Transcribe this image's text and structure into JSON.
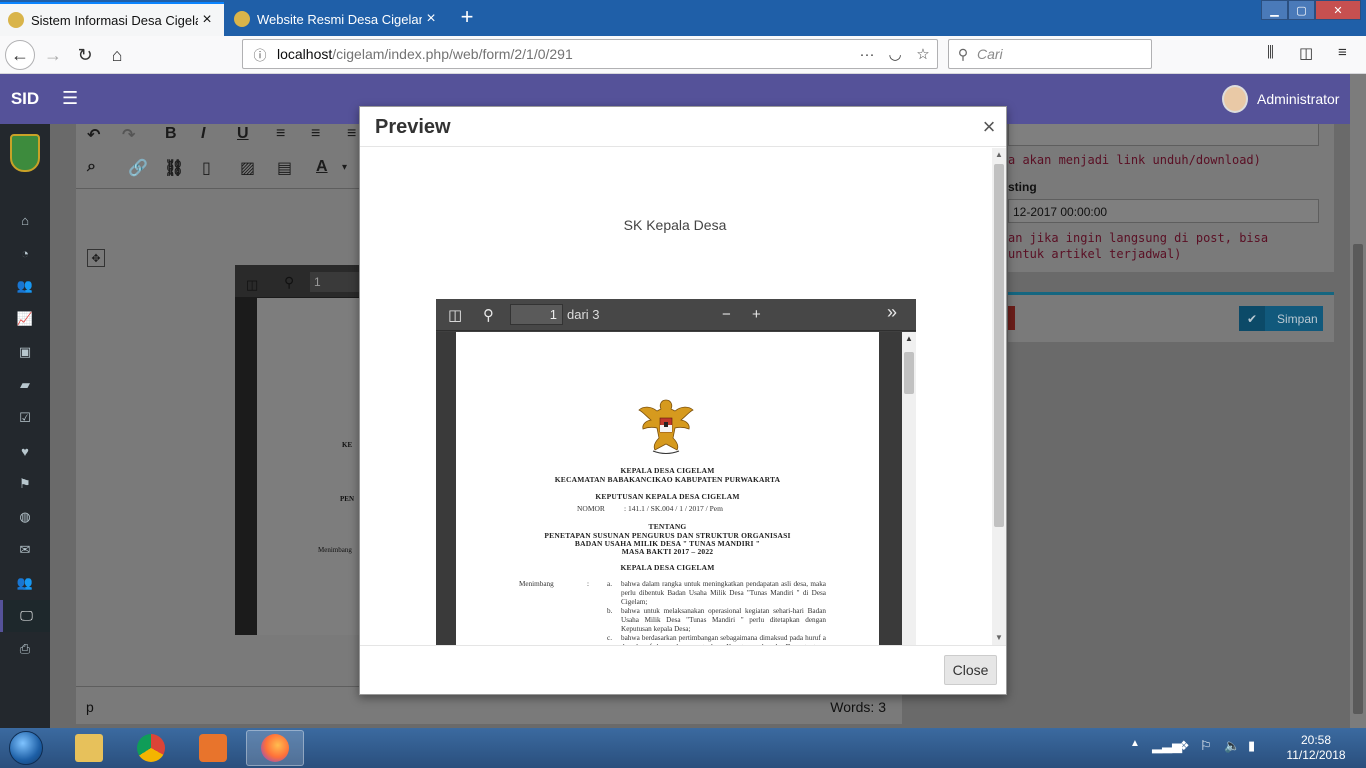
{
  "browser": {
    "tabs": [
      {
        "title": "Sistem Informasi Desa Cigelam",
        "close": "×"
      },
      {
        "title": "Website Resmi Desa Cigelam -",
        "close": "×"
      }
    ],
    "new_tab": "+",
    "url_host": "localhost",
    "url_path": "/cigelam/index.php/web/form/2/1/0/291",
    "search_placeholder": "Cari"
  },
  "app": {
    "logo": "SID",
    "user_name": "Administrator"
  },
  "underlay": {
    "right_hint_1": "a akan menjadi link unduh/download)",
    "posting_label": "sting",
    "posting_value": "12-2017 00:00:00",
    "right_hint_2": "an jika ingin langsung di post, bisa",
    "right_hint_3": " untuk artikel terjadwal)",
    "save_label": "Simpan",
    "status_path": "p",
    "word_count": "Words: 3",
    "pdf_under_page": "1",
    "doc_under_1": "KE",
    "doc_under_2": "PEN",
    "doc_under_3": "Menimbang"
  },
  "modal": {
    "title": "Preview",
    "close_icon": "×",
    "document_title": "SK Kepala Desa",
    "close_button": "Close"
  },
  "pdf_viewer": {
    "page_number": "1",
    "page_total": "dari 3",
    "zoom_out": "−",
    "zoom_in": "+",
    "more": "»"
  },
  "document": {
    "heading_1": "KEPALA DESA CIGELAM",
    "heading_2": "KECAMATAN BABAKANCIKAO KABUPATEN PURWAKARTA",
    "heading_3": "KEPUTUSAN KEPALA DESA CIGELAM",
    "number_label": "NOMOR",
    "number_value": ": 141.1 / SK.004 / 1 / 2017 / Pem",
    "about": "TENTANG",
    "subject_1": "PENETAPAN SUSUNAN PENGURUS DAN STRUKTUR ORGANISASI",
    "subject_2": "BADAN USAHA MILIK DESA \" TUNAS MANDIRI \"",
    "subject_3": "MASA BAKTI 2017 – 2022",
    "heading_4": "KEPALA DESA CIGELAM",
    "considering": "Menimbang",
    "colon": ":",
    "point_a_label": "a.",
    "point_a": "bahwa dalam rangka untuk meningkatkan pendapatan asli desa, maka perlu dibentuk Badan Usaha Milik Desa \"Tunas Mandiri \" di Desa Cigelam;",
    "point_b_label": "b.",
    "point_b": "bahwa untuk melaksanakan operasional kegiatan sehari-hari Badan Usaha Milik Desa \"Tunas Mandiri \" perlu ditetapkan dengan Keputusan kepala Desa;",
    "point_c_label": "c.",
    "point_c": "bahwa berdasarkan pertimbangan sebagaimana dimaksud pada huruf a dan huruf b, perlu menetapkan Keputusan kepala Desa tentang Penetapan Susunan Pengurus dan struktur Organisasi Badan Usaha Milik Desa \"Tunas Mandiri \" Desa Cigelam dengan masa bakti"
  },
  "taskbar": {
    "time": "20:58",
    "date": "11/12/2018"
  },
  "colors": {
    "app_header": "#555299",
    "sidebar": "#23282d",
    "browser_tabbar": "#1f5fa8"
  }
}
